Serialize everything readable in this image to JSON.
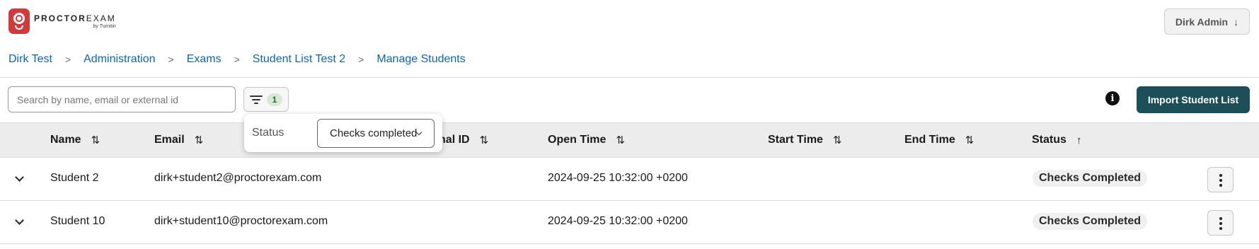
{
  "app": {
    "brand": {
      "name_bold": "PROCTOR",
      "name_light": "EXAM",
      "sub": "by Turnitin"
    },
    "user": {
      "label": "Dirk Admin",
      "icon": "arrow-down-icon",
      "arrow": "↓"
    }
  },
  "breadcrumb": [
    {
      "label": "Dirk Test"
    },
    {
      "label": "Administration"
    },
    {
      "label": "Exams"
    },
    {
      "label": "Student List Test 2"
    },
    {
      "label": "Manage Students"
    }
  ],
  "toolbar": {
    "search_placeholder": "Search by name, email or external id",
    "filter_count": "1",
    "info_glyph": "i",
    "import_label": "Import Student List"
  },
  "filter_popover": {
    "label": "Status",
    "selected": "Checks completed"
  },
  "table": {
    "columns": [
      {
        "label": "Name",
        "sort": "⇅"
      },
      {
        "label": "Email",
        "sort": "⇅"
      },
      {
        "label": "External ID",
        "sort": "⇅"
      },
      {
        "label": "Open Time",
        "sort": "⇅"
      },
      {
        "label": "Start Time",
        "sort": "⇅"
      },
      {
        "label": "End Time",
        "sort": "⇅"
      },
      {
        "label": "Status",
        "sort": "↑"
      }
    ],
    "rows": [
      {
        "name": "Student 2",
        "email": "dirk+student2@proctorexam.com",
        "external_id": "",
        "open_time": "2024-09-25 10:32:00 +0200",
        "start_time": "",
        "end_time": "",
        "status": "Checks Completed"
      },
      {
        "name": "Student 10",
        "email": "dirk+student10@proctorexam.com",
        "external_id": "",
        "open_time": "2024-09-25 10:32:00 +0200",
        "start_time": "",
        "end_time": "",
        "status": "Checks Completed"
      }
    ]
  },
  "colors": {
    "link": "#0a67b5",
    "primary": "#1c4f58",
    "brand_red": "#d13a3a",
    "badge_green_bg": "#d7ead8"
  }
}
